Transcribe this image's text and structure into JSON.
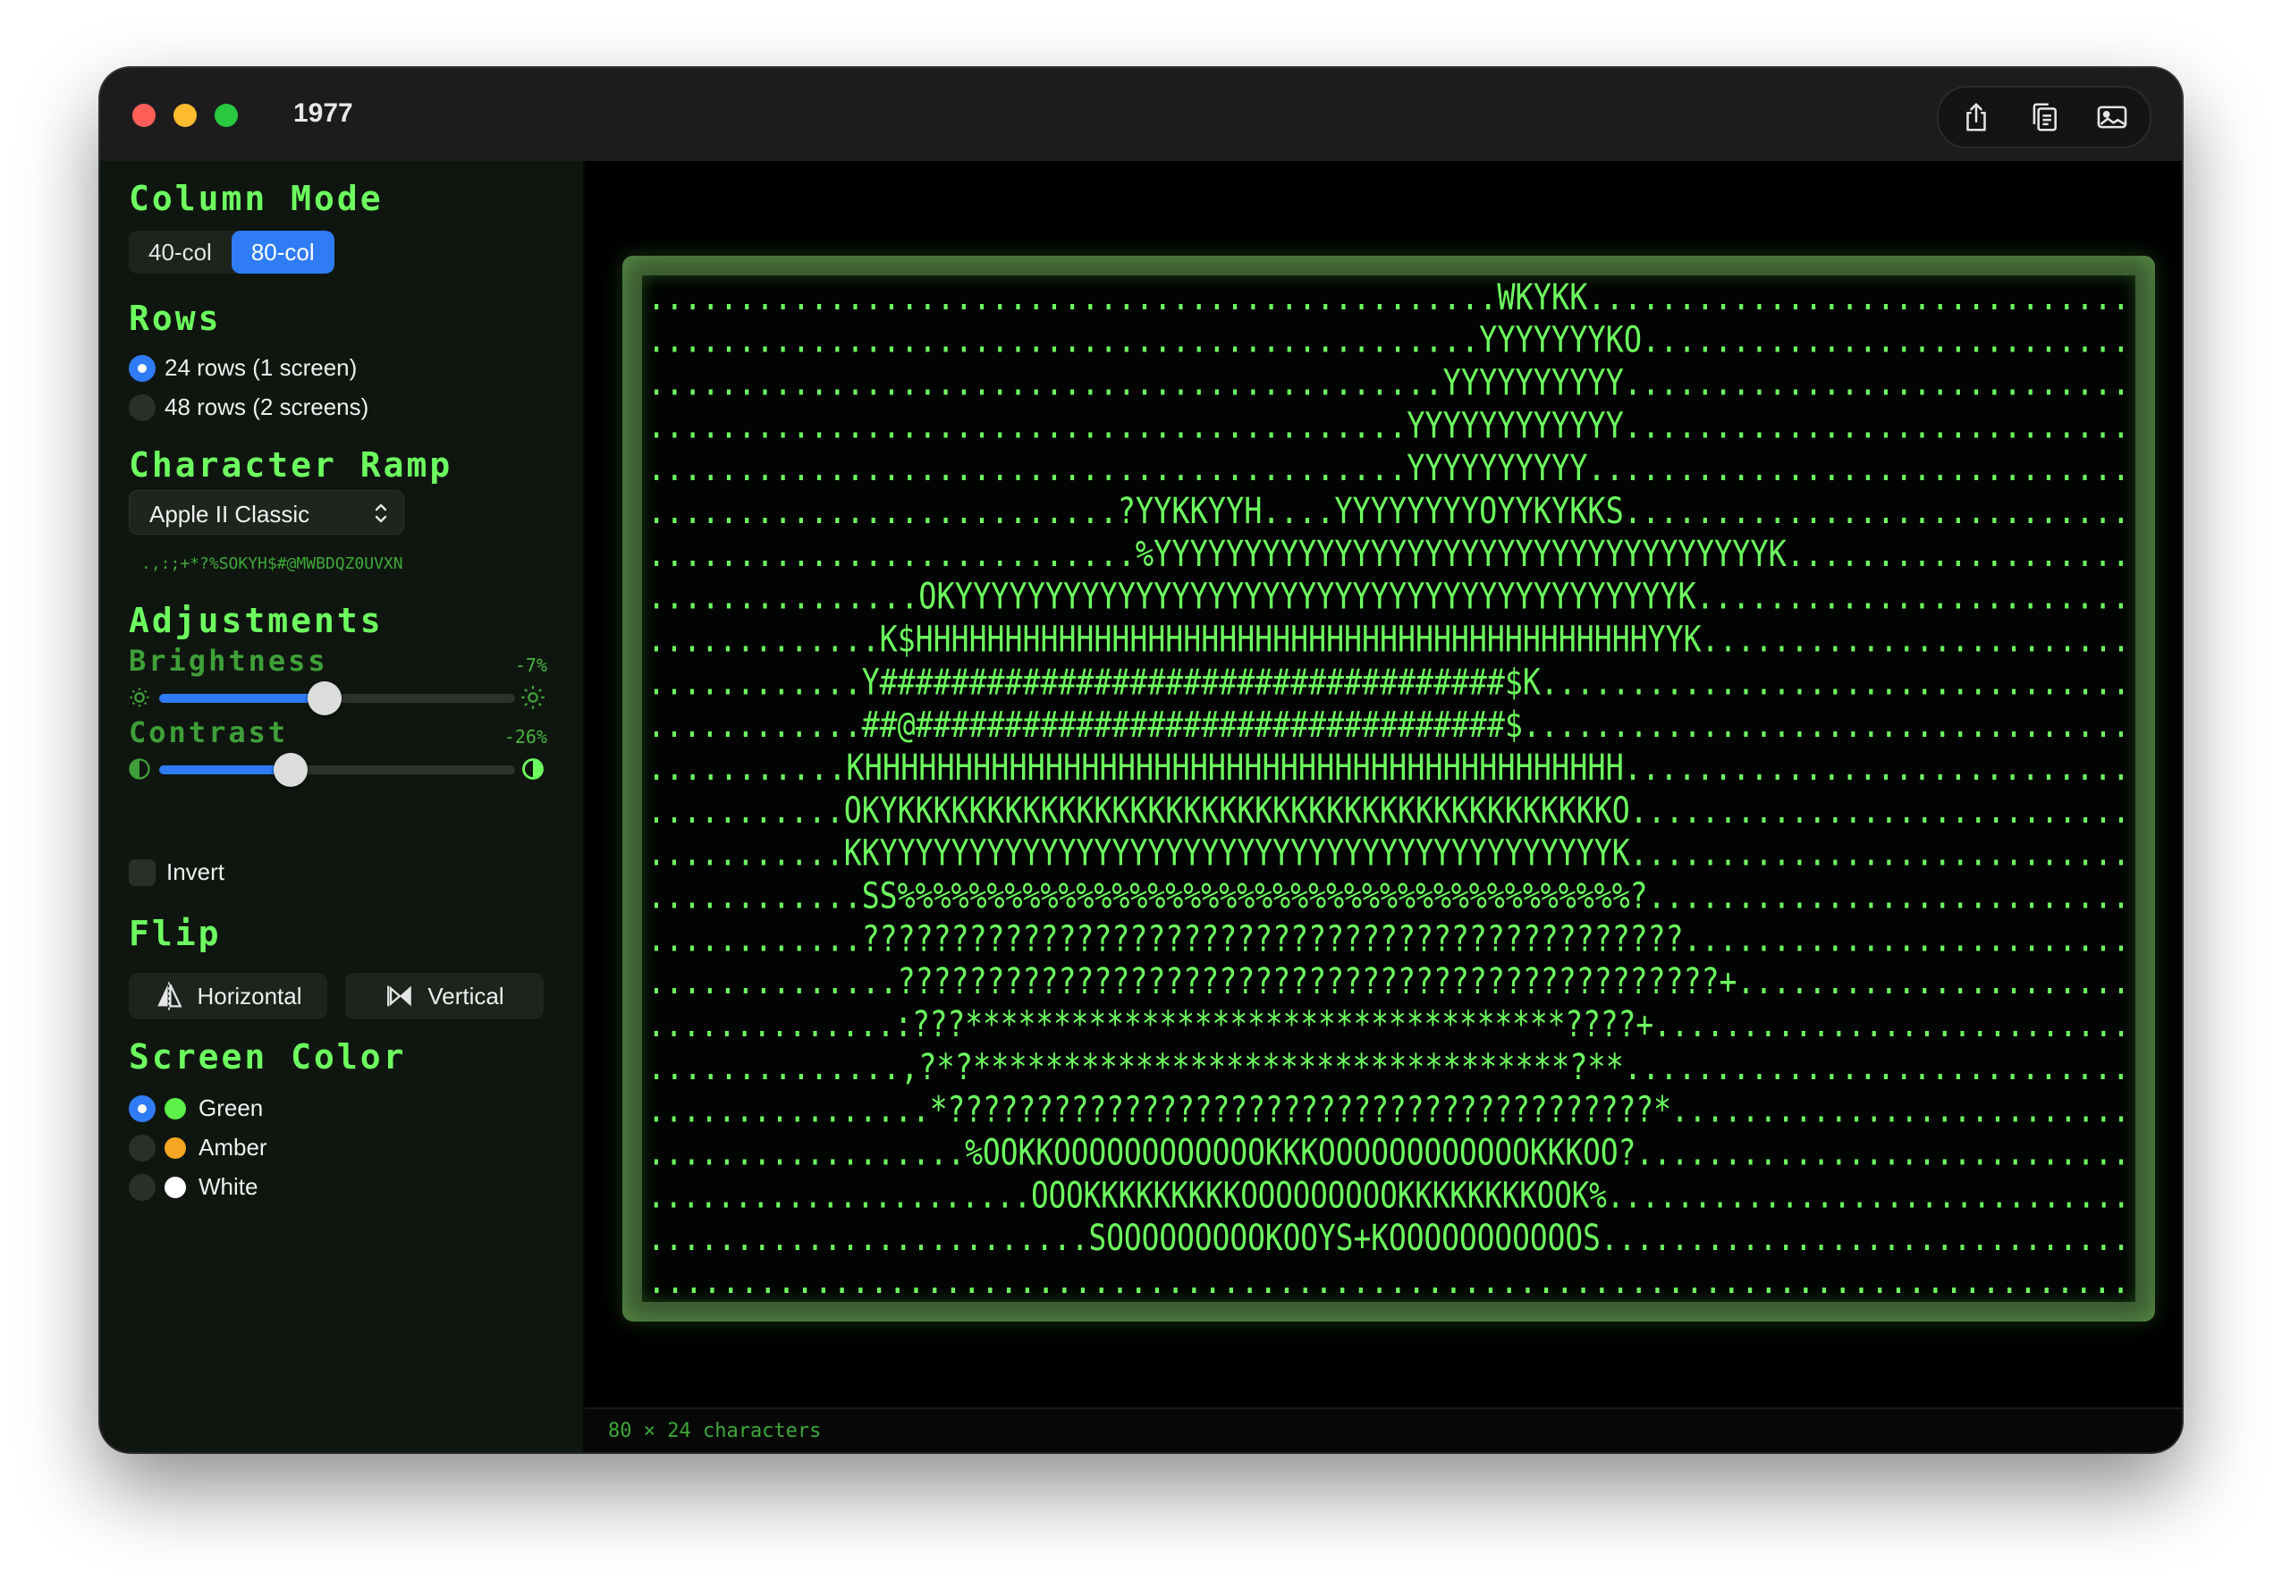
{
  "window": {
    "title": "1977"
  },
  "toolbar": {
    "icons": [
      "share-icon",
      "copy-icon",
      "image-icon"
    ]
  },
  "sidebar": {
    "column_mode": {
      "title": "Column Mode",
      "options": [
        "40-col",
        "80-col"
      ],
      "selected": "80-col"
    },
    "rows": {
      "title": "Rows",
      "options": [
        {
          "label": "24 rows (1 screen)",
          "selected": true
        },
        {
          "label": "48 rows (2 screens)",
          "selected": false
        }
      ]
    },
    "character_ramp": {
      "title": "Character Ramp",
      "selected": "Apple II Classic",
      "ramp": " .,:;+*?%SOKYH$#@MWBDQZ0UVXN"
    },
    "adjustments": {
      "title": "Adjustments",
      "brightness": {
        "label": "Brightness",
        "value": "-7%",
        "fraction": 0.465
      },
      "contrast": {
        "label": "Contrast",
        "value": "-26%",
        "fraction": 0.37
      },
      "invert": {
        "label": "Invert",
        "checked": false
      }
    },
    "flip": {
      "title": "Flip",
      "horizontal": "Horizontal",
      "vertical": "Vertical"
    },
    "screen_color": {
      "title": "Screen Color",
      "options": [
        {
          "label": "Green",
          "color": "#5cf04a",
          "selected": true
        },
        {
          "label": "Amber",
          "color": "#f5a623",
          "selected": false
        },
        {
          "label": "White",
          "color": "#ffffff",
          "selected": false
        }
      ]
    }
  },
  "colors": {
    "accent": "#2f7cf6",
    "phosphor": "#6dff5f"
  },
  "status": {
    "text": "80 × 24 characters"
  },
  "ascii": {
    "lines": [
      "...............................................WKYKK..............................",
      "..............................................YYYYYYYKO...........................",
      "............................................YYYYYYYYYY............................",
      "..........................................YYYYYYYYYYYY............................",
      "..........................................YYYYYYYYYY..............................",
      "..........................?YYKKYYH....YYYYYYYYOYYKYKKS............................",
      "...........................%YYYYYYYYYYYYYYYYYYYYYYYYYYYYYYYYYYK...................",
      "...............OKYYYYYYYYYYYYYYYYYYYYYYYYYYYYYYYYYYYYYYYYK........................",
      ".............K$HHHHHHHHHHHHHHHHHHHHHHHHHHHHHHHHHHHHHHHHHYYK........................",
      "............Y###################################$K.................................",
      "............##@#################################$..................................",
      "...........KHHHHHHHHHHHHHHHHHHHHHHHHHHHHHHHHHHHHHHHHHH............................",
      "...........OKYKKKKKKKKKKKKKKKKKKKKKKKKKKKKKKKKKKKKKKKKO............................",
      "...........KKYYYYYYYYYYYYYYYYYYYYYYYYYYYYYYYYYYYYYYYYYK............................",
      "............SS%%%%%%%%%%%%%%%%%%%%%%%%%%%%%%%%%%%%%%%%%?...........................",
      "............??????????????????????????????????????????????.........................",
      "..............??????????????????????????????????????????????+......................",
      "..............:???**********************************????+...........................",
      "..............,?*?*********************************?**............................",
      "................*????????????????????????????????????????*..........................",
      "..................%OOKKOOOOOOOOOOOOKKKOOOOOOOOOOOOKKKOO?............................",
      "......................OOOKKKKKKKKKOOOOOOOOOKKKKKKKKOOK%..............................",
      ".........................SOOOOOOOOOKOOYS+KOOOOOOOOOOOS..............................",
      "................................................................................"
    ]
  }
}
